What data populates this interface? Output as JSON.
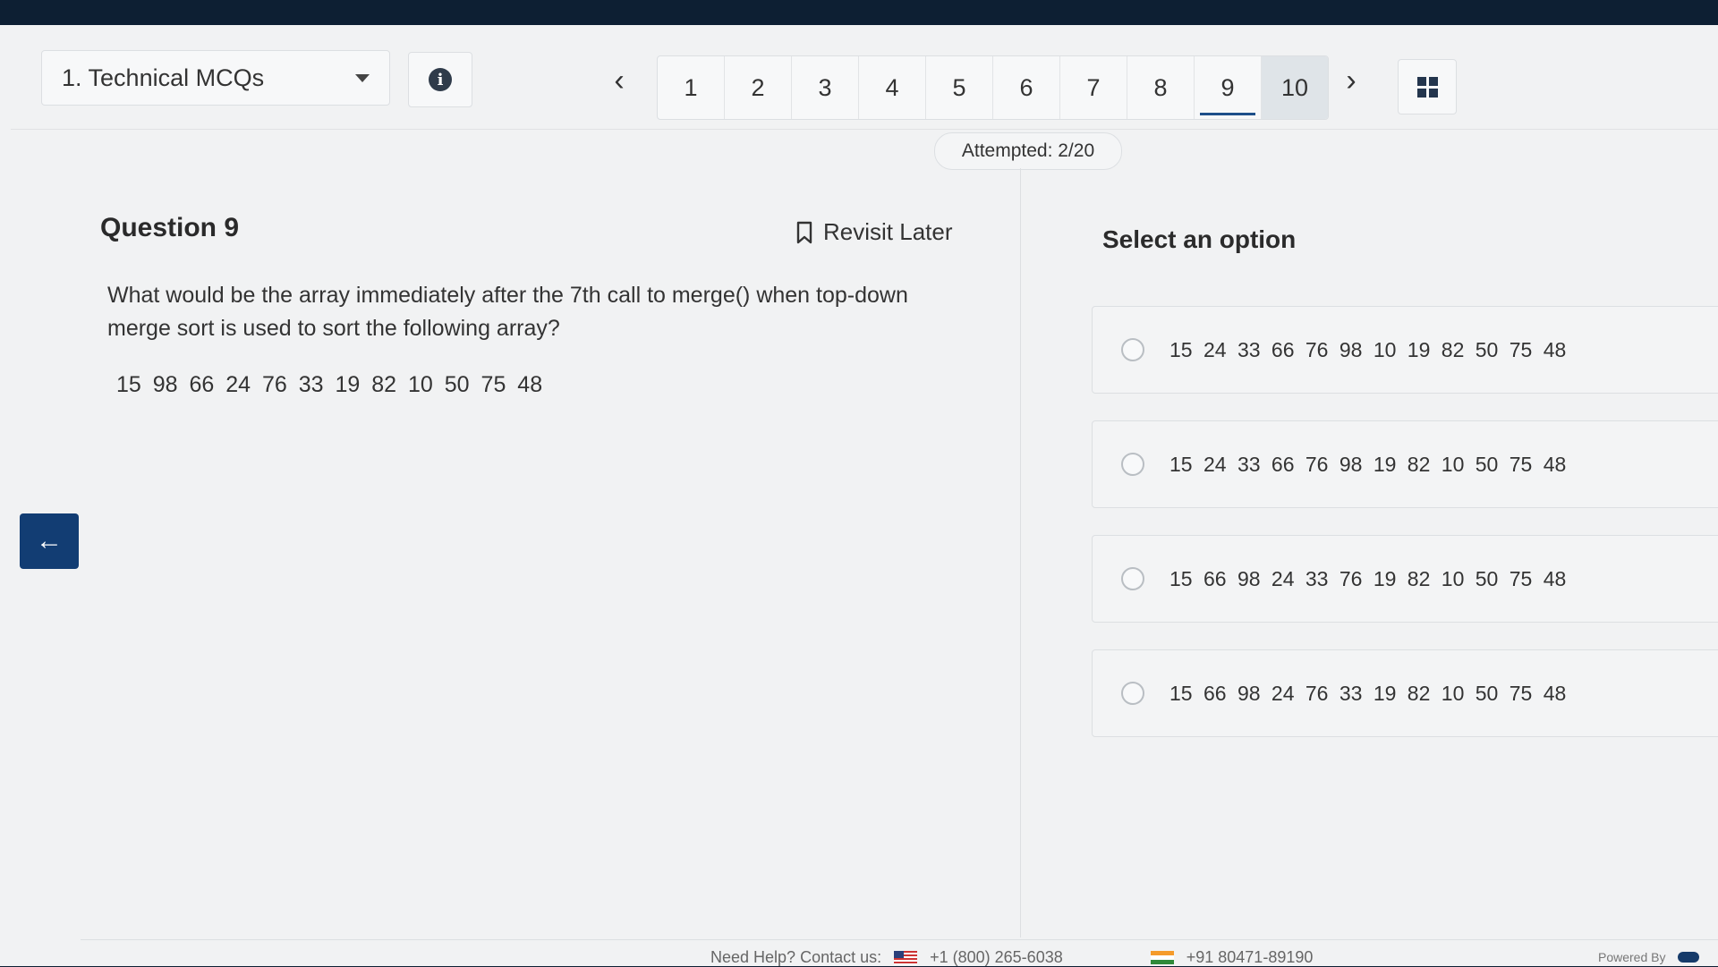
{
  "header": {
    "section_label": "1. Technical MCQs",
    "pages": [
      "1",
      "2",
      "3",
      "4",
      "5",
      "6",
      "7",
      "8",
      "9",
      "10"
    ],
    "current_page": "9",
    "attempted": "Attempted: 2/20"
  },
  "question": {
    "title": "Question 9",
    "revisit_label": "Revisit Later",
    "text": "What would be the array immediately after the 7th call to merge() when top-down merge sort is used to sort the following array?",
    "array": "15 98 66 24 76 33 19 82 10 50 75 48"
  },
  "options": {
    "heading": "Select an option",
    "items": [
      "15 24 33 66 76 98 10 19 82 50 75 48",
      "15 24 33 66 76 98 19 82 10 50 75 48",
      "15 66 98 24 33 76 19 82 10 50 75 48",
      "15 66 98 24 76 33 19 82 10 50 75 48"
    ]
  },
  "footer": {
    "help_label": "Need Help? Contact us:",
    "us_phone": "+1 (800) 265-6038",
    "in_phone": "+91 80471-89190",
    "powered_by": "Powered By"
  },
  "colors": {
    "accent": "#123d73",
    "background": "#f1f2f3"
  }
}
